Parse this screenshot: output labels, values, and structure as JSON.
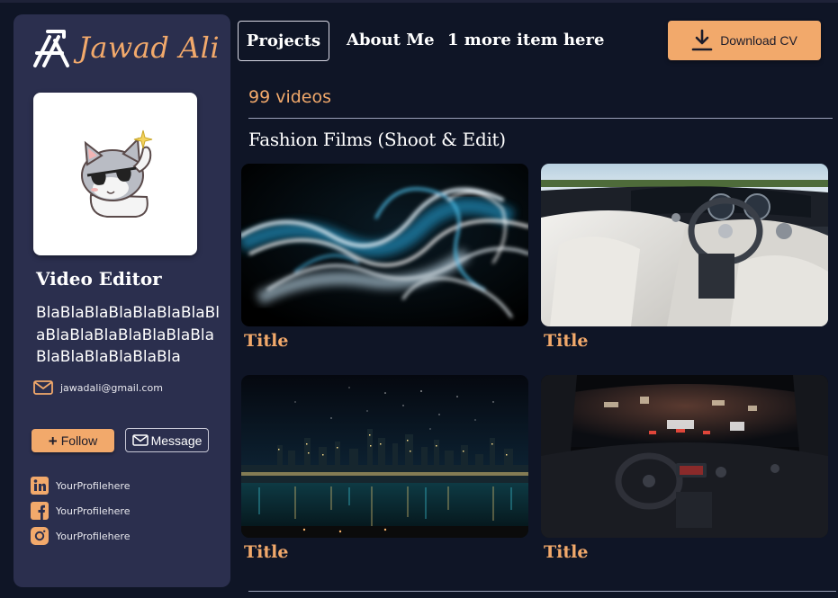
{
  "brand": {
    "name": "Jawad Ali",
    "logo_icon": "aperture-logo-icon"
  },
  "profile": {
    "avatar_icon": "cat-sunglasses-sticker",
    "role": "Video Editor",
    "bio": "BlaBlaBlaBlaBlaBlaBlaBlaBlaBlaBlaBlaBlaBlaBlaBlaBlaBlaBlaBlaBla",
    "email": "jawadali@gmail.com"
  },
  "actions": {
    "follow": "Follow",
    "message": "Message"
  },
  "socials": [
    {
      "icon": "linkedin-icon",
      "label": "YourProfilehere"
    },
    {
      "icon": "facebook-icon",
      "label": "YourProfilehere"
    },
    {
      "icon": "instagram-icon",
      "label": "YourProfilehere"
    }
  ],
  "nav": {
    "items": [
      "Projects",
      "About Me",
      "1 more item here"
    ],
    "active": "Projects",
    "download_cv": "Download CV"
  },
  "main": {
    "video_count": "99 videos",
    "section_title": "Fashion Films (Shoot & Edit)",
    "cards": [
      {
        "title": "Title",
        "thumbnail": "smoke-abstract"
      },
      {
        "title": "Title",
        "thumbnail": "car-interior-white"
      },
      {
        "title": "Title",
        "thumbnail": "city-skyline-night"
      },
      {
        "title": "Title",
        "thumbnail": "car-interior-night-street"
      }
    ]
  },
  "colors": {
    "background": "#0f1526",
    "sidebar": "#2b2f4e",
    "accent": "#f2a96b",
    "text": "#ffffff"
  }
}
